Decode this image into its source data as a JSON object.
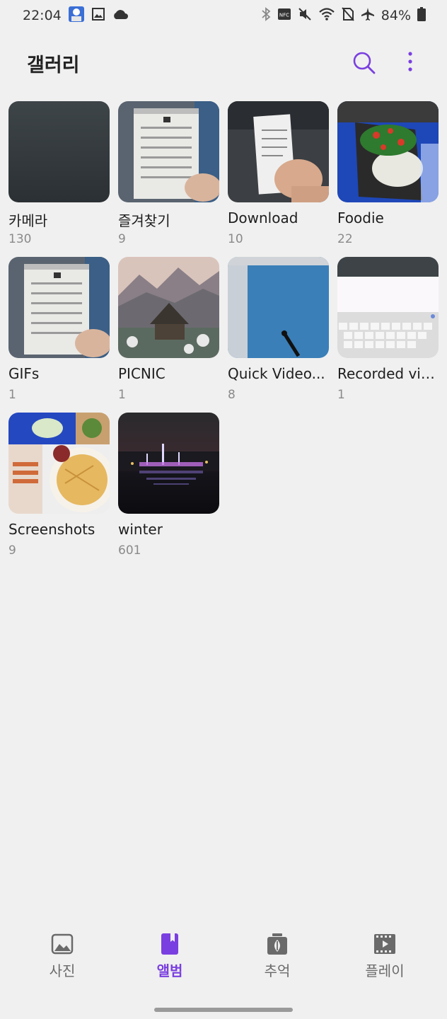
{
  "status_bar": {
    "time": "22:04",
    "battery": "84%",
    "left_icons": [
      "app-avatar-icon",
      "image-icon",
      "cloud-icon"
    ],
    "right_icons": [
      "bluetooth-icon",
      "nfc-icon",
      "mute-icon",
      "wifi-icon",
      "no-sim-icon",
      "airplane-icon",
      "battery-icon"
    ]
  },
  "app": {
    "title": "갤러리",
    "accent": "#7a3fe0"
  },
  "albums": [
    {
      "name": "카메라",
      "count": "130"
    },
    {
      "name": "즐겨찾기",
      "count": "9"
    },
    {
      "name": "Download",
      "count": "10"
    },
    {
      "name": "Foodie",
      "count": "22"
    },
    {
      "name": "GIFs",
      "count": "1"
    },
    {
      "name": "PICNIC",
      "count": "1"
    },
    {
      "name": "Quick Video...",
      "count": "8"
    },
    {
      "name": "Recorded vid...",
      "count": "1"
    },
    {
      "name": "Screenshots",
      "count": "9"
    },
    {
      "name": "winter",
      "count": "601"
    }
  ],
  "bottom_nav": {
    "items": [
      {
        "label": "사진",
        "icon": "photo-icon"
      },
      {
        "label": "앨범",
        "icon": "album-icon"
      },
      {
        "label": "추억",
        "icon": "memories-icon"
      },
      {
        "label": "플레이",
        "icon": "play-film-icon"
      }
    ],
    "active_index": 1
  }
}
